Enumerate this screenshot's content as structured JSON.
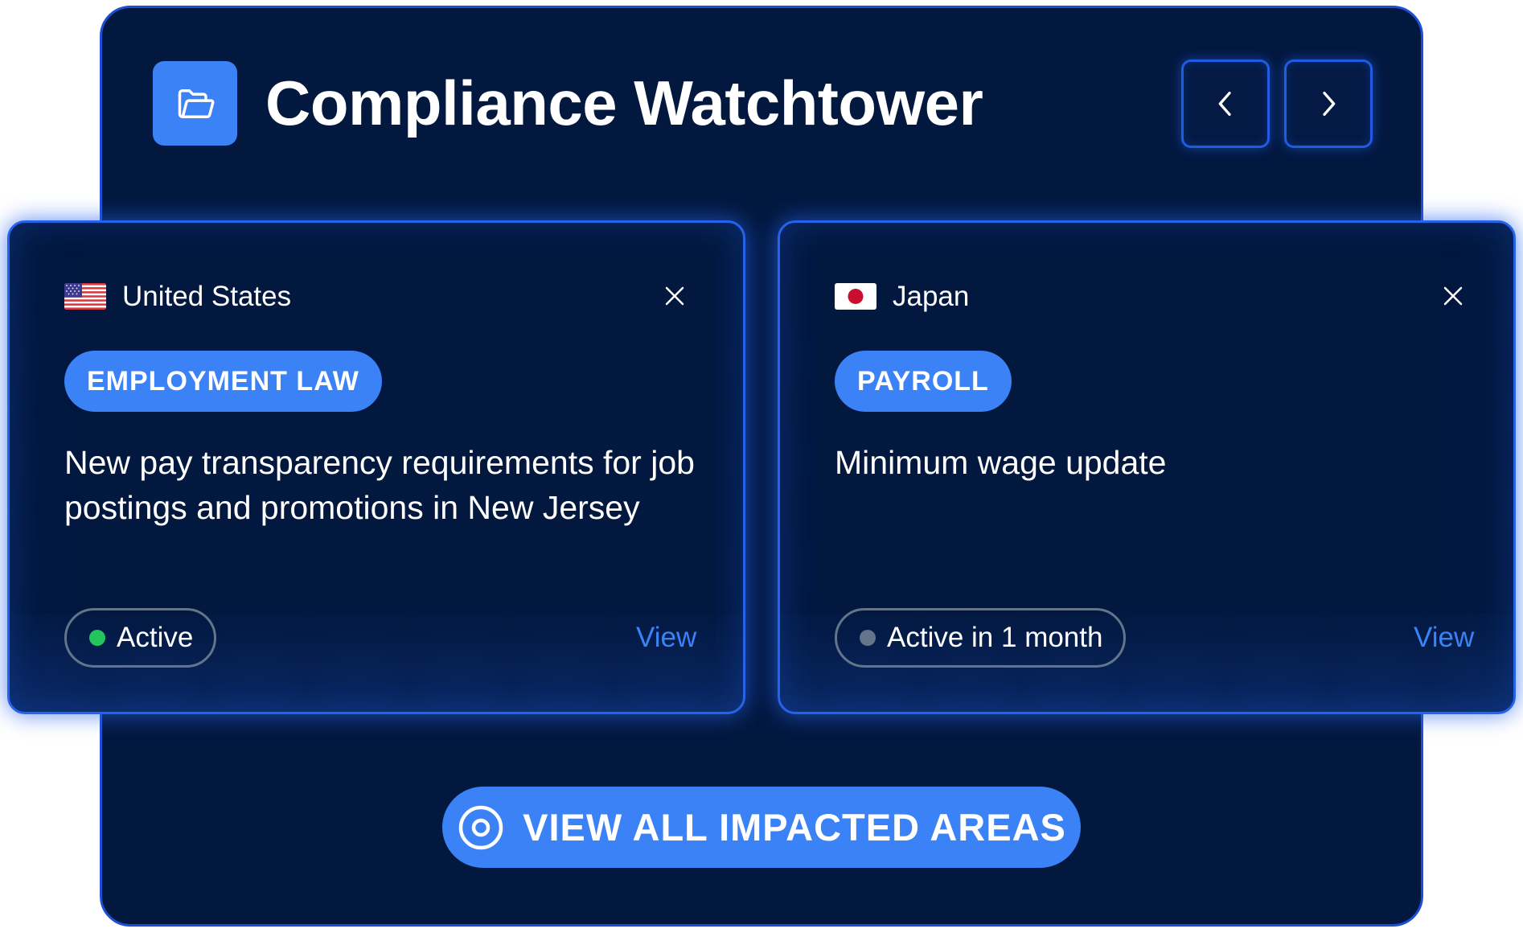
{
  "header": {
    "title": "Compliance Watchtower",
    "icon": "folder-icon",
    "prev_icon": "chevron-left-icon",
    "next_icon": "chevron-right-icon"
  },
  "cards": [
    {
      "country": "United States",
      "flag": "us-flag-icon",
      "tag": "EMPLOYMENT LAW",
      "description": "New pay transparency requirements for job postings and promotions in New Jersey",
      "status": "Active",
      "status_color": "#22c55e",
      "view_label": "View"
    },
    {
      "country": "Japan",
      "flag": "japan-flag-icon",
      "tag": "PAYROLL",
      "description": "Minimum wage update",
      "status": "Active in 1 month",
      "status_color": "#64748b",
      "view_label": "View"
    }
  ],
  "cta": {
    "label": "VIEW ALL IMPACTED AREAS",
    "icon": "eye-icon"
  },
  "colors": {
    "background": "#03183f",
    "accent": "#3b82f6",
    "border": "#2563eb"
  }
}
